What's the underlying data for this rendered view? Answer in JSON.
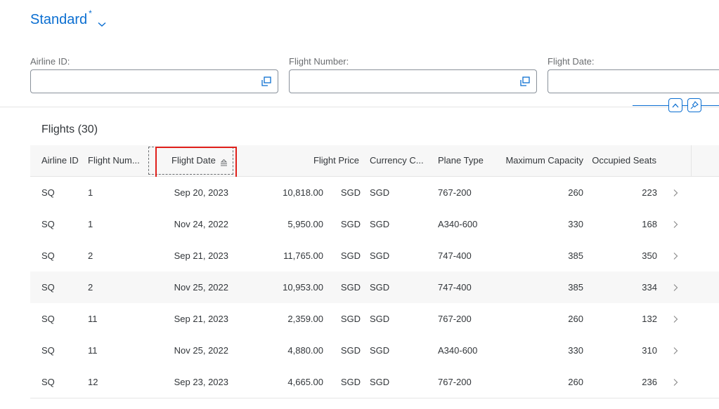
{
  "variant": {
    "title": "Standard",
    "modified_marker": "*"
  },
  "filters": [
    {
      "label": "Airline ID:",
      "value": ""
    },
    {
      "label": "Flight Number:",
      "value": ""
    },
    {
      "label": "Flight Date:",
      "value": ""
    }
  ],
  "table": {
    "title": "Flights (30)",
    "columns": [
      "Airline ID",
      "Flight Num...",
      "Flight Date",
      "Flight Price",
      "Currency C...",
      "Plane Type",
      "Maximum Capacity",
      "Occupied Seats"
    ],
    "sorted_column": "Flight Date",
    "sort_direction": "ascending",
    "rows": [
      {
        "airline": "SQ",
        "flight": "1",
        "date": "Sep 20, 2023",
        "price": "10,818.00",
        "price_cur": "SGD",
        "currency": "SGD",
        "plane": "767-200",
        "max": "260",
        "occ": "223"
      },
      {
        "airline": "SQ",
        "flight": "1",
        "date": "Nov 24, 2022",
        "price": "5,950.00",
        "price_cur": "SGD",
        "currency": "SGD",
        "plane": "A340-600",
        "max": "330",
        "occ": "168"
      },
      {
        "airline": "SQ",
        "flight": "2",
        "date": "Sep 21, 2023",
        "price": "11,765.00",
        "price_cur": "SGD",
        "currency": "SGD",
        "plane": "747-400",
        "max": "385",
        "occ": "350"
      },
      {
        "airline": "SQ",
        "flight": "2",
        "date": "Nov 25, 2022",
        "price": "10,953.00",
        "price_cur": "SGD",
        "currency": "SGD",
        "plane": "747-400",
        "max": "385",
        "occ": "334"
      },
      {
        "airline": "SQ",
        "flight": "11",
        "date": "Sep 21, 2023",
        "price": "2,359.00",
        "price_cur": "SGD",
        "currency": "SGD",
        "plane": "767-200",
        "max": "260",
        "occ": "132"
      },
      {
        "airline": "SQ",
        "flight": "11",
        "date": "Nov 25, 2022",
        "price": "4,880.00",
        "price_cur": "SGD",
        "currency": "SGD",
        "plane": "A340-600",
        "max": "330",
        "occ": "310"
      },
      {
        "airline": "SQ",
        "flight": "12",
        "date": "Sep 23, 2023",
        "price": "4,665.00",
        "price_cur": "SGD",
        "currency": "SGD",
        "plane": "767-200",
        "max": "260",
        "occ": "236"
      }
    ]
  },
  "colors": {
    "accent": "#0a6ed1",
    "highlight": "#e0201b",
    "row_alt": "#f7f7f7"
  },
  "icons": [
    "chevron-down-icon",
    "value-help-icon",
    "collapse-up-icon",
    "pin-icon",
    "sort-ascending-icon",
    "row-navigation-icon"
  ]
}
